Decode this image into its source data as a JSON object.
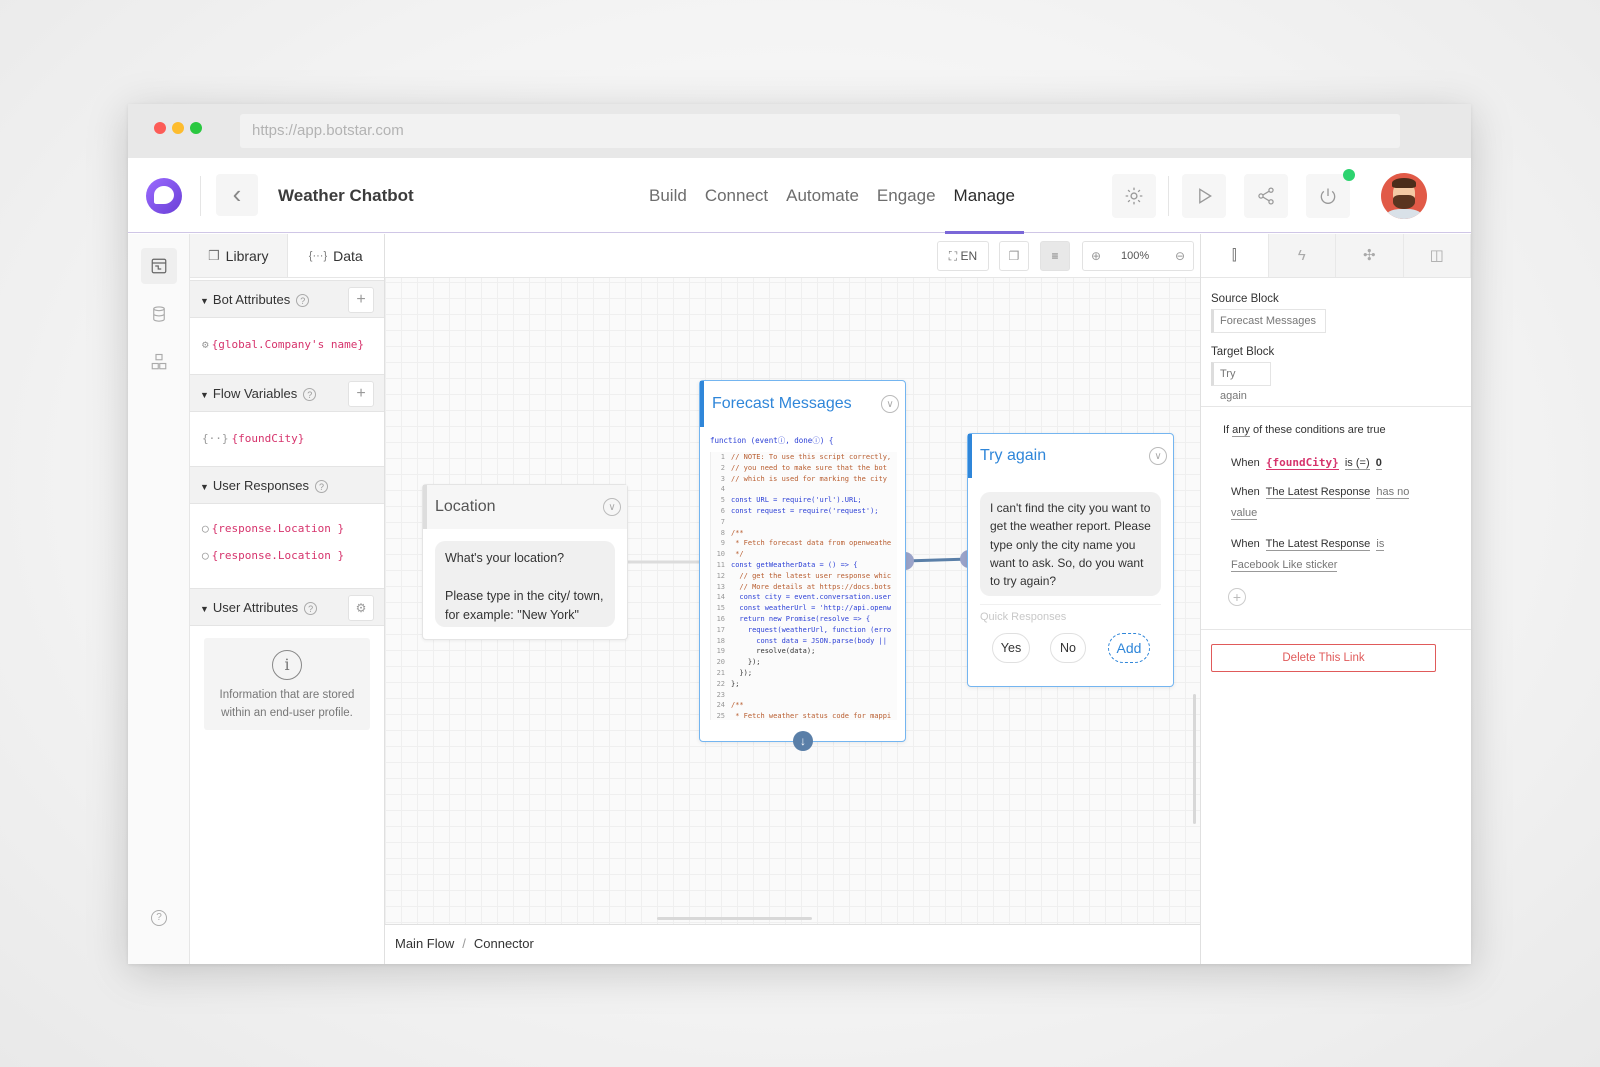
{
  "browser": {
    "url": "https://app.botstar.com"
  },
  "header": {
    "app_title": "Weather Chatbot",
    "nav": [
      "Build",
      "Connect",
      "Automate",
      "Engage",
      "Manage"
    ],
    "active_nav": "Manage",
    "icons": [
      "settings-icon",
      "play-icon",
      "share-icon",
      "power-icon"
    ]
  },
  "library": {
    "tabs": {
      "library": "Library",
      "data": "Data"
    },
    "sections": {
      "bot_attributes": {
        "title": "Bot Attributes",
        "items": [
          "{global.Company's name}"
        ]
      },
      "flow_variables": {
        "title": "Flow Variables",
        "items": [
          "{foundCity}"
        ]
      },
      "user_responses": {
        "title": "User Responses",
        "items": [
          "{response.Location }",
          "{response.Location }"
        ]
      },
      "user_attributes": {
        "title": "User Attributes",
        "info": "Information that are stored within an end-user profile."
      }
    }
  },
  "toolbar": {
    "language": "EN",
    "zoom": "100%"
  },
  "blocks": {
    "location": {
      "title": "Location",
      "message_line1": "What's your location?",
      "message_line2": "Please type in the city/ town, for example: \"New York\""
    },
    "forecast": {
      "title": "Forecast Messages",
      "signature": "function (eventⓘ, doneⓘ) {",
      "code": [
        "// NOTE: To use this script correctly,",
        "// you need to make sure that the bot",
        "// which is used for marking the city",
        "",
        "const URL = require('url').URL;",
        "const request = require('request');",
        "",
        "/**",
        " * Fetch forecast data from openweathe",
        " */",
        "const getWeatherData = () => {",
        "  // get the latest user response whic",
        "  // More details at https://docs.bots",
        "  const city = event.conversation.user",
        "  const weatherUrl = 'http://api.openw",
        "  return new Promise(resolve => {",
        "    request(weatherUrl, function (erro",
        "      const data = JSON.parse(body ||",
        "      resolve(data);",
        "    });",
        "  });",
        "};",
        "",
        "/**",
        " * Fetch weather status code for mappi"
      ]
    },
    "try_again": {
      "title": "Try again",
      "message": "I can't find the city you want to get the weather report. Please type only the city name you want to ask. So, do you want to try again?",
      "quick_responses_label": "Quick Responses",
      "buttons": [
        "Yes",
        "No",
        "Add"
      ]
    }
  },
  "breadcrumb": [
    "Main Flow",
    "Connector"
  ],
  "right_panel": {
    "source_label": "Source Block",
    "source_value": "Forecast Messages",
    "target_label": "Target Block",
    "target_value": "Try again",
    "condition_header_pre": "If ",
    "condition_header_any": "any",
    "condition_header_post": " of these conditions are true",
    "conditions": [
      {
        "when": "When",
        "subject": "{foundCity}",
        "op": "is (=)",
        "value": "0"
      },
      {
        "when": "When",
        "subject": "The Latest Response",
        "op": "has no",
        "value": "value"
      },
      {
        "when": "When",
        "subject": "The Latest Response",
        "op": "is",
        "value": "Facebook Like sticker"
      }
    ],
    "delete_label": "Delete This Link"
  }
}
